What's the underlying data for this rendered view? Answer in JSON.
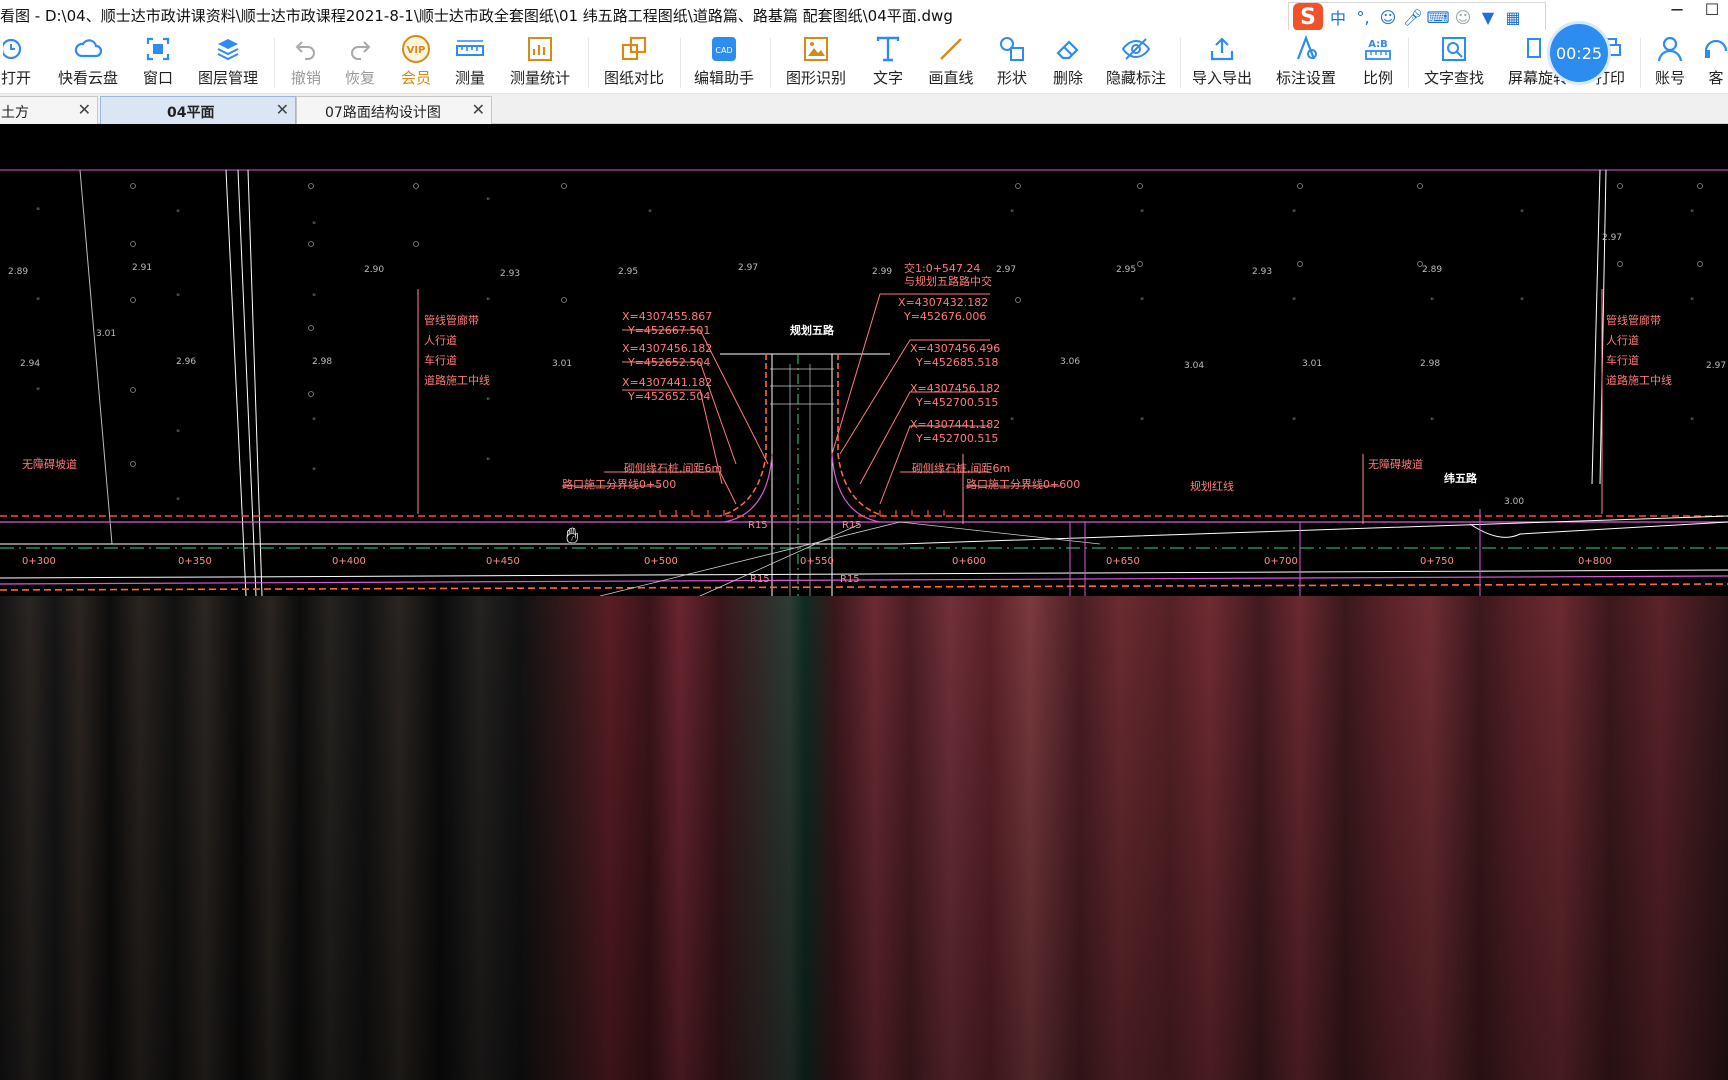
{
  "window": {
    "title": "看图 - D:\\04、顺士达市政讲课资料\\顺士达市政课程2021-8-1\\顺士达市政全套图纸\\01 纬五路工程图纸\\道路篇、路基篇 配套图纸\\04平面.dwg",
    "minimize": "─",
    "maximize": "☐"
  },
  "ime": {
    "logo": "S",
    "mode": "中",
    "punct": "°,",
    "items": [
      "emoji-icon",
      "mic-icon",
      "keyboard-icon",
      "user-icon",
      "shirt-icon",
      "grid-icon"
    ]
  },
  "toolbar": {
    "items": [
      {
        "label": "打开",
        "icon": "clock-icon"
      },
      {
        "label": "快看云盘",
        "icon": "cloud-icon"
      },
      {
        "label": "窗口",
        "icon": "window-icon"
      },
      {
        "label": "图层管理",
        "icon": "layers-icon"
      },
      {
        "label": "撤销",
        "icon": "undo-icon"
      },
      {
        "label": "恢复",
        "icon": "redo-icon"
      },
      {
        "label": "会员",
        "icon": "vip-icon"
      },
      {
        "label": "测量",
        "icon": "ruler-icon"
      },
      {
        "label": "测量统计",
        "icon": "measure-stats-icon"
      },
      {
        "label": "图纸对比",
        "icon": "compare-icon"
      },
      {
        "label": "编辑助手",
        "icon": "cad-edit-icon"
      },
      {
        "label": "图形识别",
        "icon": "shape-recognize-icon"
      },
      {
        "label": "文字",
        "icon": "text-icon"
      },
      {
        "label": "画直线",
        "icon": "line-icon"
      },
      {
        "label": "形状",
        "icon": "shapes-icon"
      },
      {
        "label": "删除",
        "icon": "eraser-icon"
      },
      {
        "label": "隐藏标注",
        "icon": "eye-hide-icon"
      },
      {
        "label": "导入导出",
        "icon": "export-icon"
      },
      {
        "label": "标注设置",
        "icon": "annotation-settings-icon"
      },
      {
        "label": "比例",
        "icon": "scale-icon"
      },
      {
        "label": "文字查找",
        "icon": "text-search-icon"
      },
      {
        "label": "屏幕旋转",
        "icon": "rotate-icon"
      },
      {
        "label": "打印",
        "icon": "print-icon"
      },
      {
        "label": "账号",
        "icon": "account-icon"
      },
      {
        "label": "客",
        "icon": "service-icon"
      }
    ],
    "vip_text": "VIP",
    "timer": "00:25"
  },
  "tabs": [
    {
      "label": "土方",
      "active": false
    },
    {
      "label": "04平面",
      "active": true
    },
    {
      "label": "07路面结构设计图",
      "active": false
    }
  ],
  "drawing": {
    "road_name_top": "规划五路",
    "road_name_right": "纬五路",
    "coords_left": [
      "X=4307455.867",
      "Y=452667.501",
      "X=4307456.182",
      "Y=452652.504",
      "X=4307441.182",
      "Y=452652.504"
    ],
    "coords_right": [
      "交1:0+547.24",
      "与规划五路路中交",
      "X=4307432.182",
      "Y=452676.006",
      "X=4307456.496",
      "Y=452685.518",
      "X=4307456.182",
      "Y=452700.515",
      "X=4307441.182",
      "Y=452700.515"
    ],
    "legend_left": [
      "管线管廊带",
      "人行道",
      "车行道",
      "道路施工中线"
    ],
    "legend_right": [
      "管线管廊带",
      "人行道",
      "车行道",
      "道路施工中线"
    ],
    "notes": [
      "砌侧缘石桩,间距6m",
      "砌侧缘石桩,间距6m",
      "路口施工分界线0+500",
      "路口施工分界线0+600",
      "无障碍坡道",
      "无障碍坡道",
      "规划红线"
    ],
    "stations": [
      "0+300",
      "0+350",
      "0+400",
      "0+450",
      "0+500",
      "0+550",
      "0+600",
      "0+650",
      "0+700",
      "0+750",
      "0+800"
    ],
    "radii": [
      "R15",
      "R15",
      "R15",
      "R15"
    ],
    "elevations": [
      "2.89",
      "2.91",
      "2.90",
      "2.93",
      "2.95",
      "2.97",
      "2.99",
      "2.97",
      "2.95",
      "2.93",
      "2.89",
      "2.97",
      "2.96",
      "2.98",
      "3.01",
      "3.01",
      "3.06",
      "3.04",
      "3.01",
      "2.98",
      "2.97",
      "2.94",
      "3.00"
    ]
  },
  "colors": {
    "redline": "#ff4a3a",
    "annot": "#ff7a7a",
    "road": "#ffffff",
    "magenta": "#d65bd6",
    "green": "#3ad07a",
    "dashed_orange": "#ff6a2a"
  }
}
